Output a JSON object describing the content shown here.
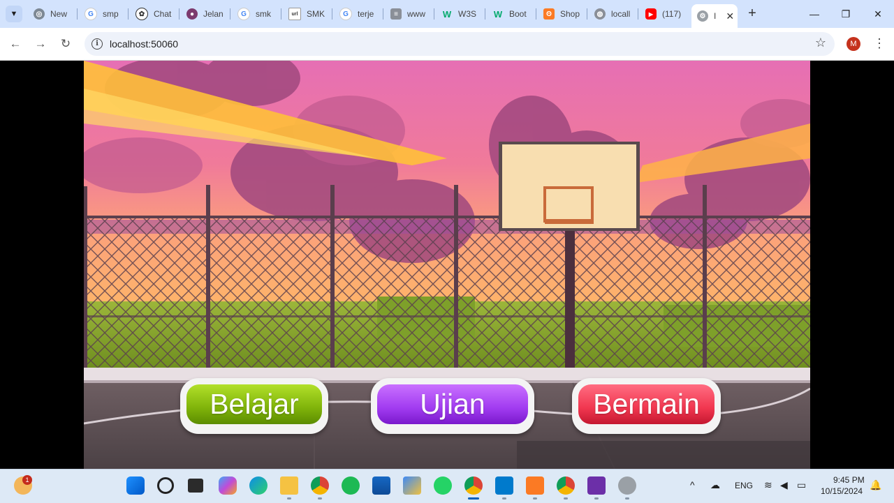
{
  "browser": {
    "tabs": [
      {
        "label": "New",
        "favicon": "chrome-icon"
      },
      {
        "label": "smp",
        "favicon": "google-icon"
      },
      {
        "label": "Chat",
        "favicon": "openai-icon"
      },
      {
        "label": "Jelan",
        "favicon": "site-icon"
      },
      {
        "label": "smk",
        "favicon": "google-icon"
      },
      {
        "label": "SMK",
        "favicon": "site-icon"
      },
      {
        "label": "terje",
        "favicon": "google-icon"
      },
      {
        "label": "www",
        "favicon": "doc-icon"
      },
      {
        "label": "W3S",
        "favicon": "w3schools-icon"
      },
      {
        "label": "Boot",
        "favicon": "w3schools-icon"
      },
      {
        "label": "Shop",
        "favicon": "xampp-icon"
      },
      {
        "label": "locall",
        "favicon": "globe-icon"
      },
      {
        "label": "(117)",
        "favicon": "youtube-icon"
      },
      {
        "label": "I",
        "favicon": "gear-icon",
        "active": true
      }
    ],
    "url": "localhost:50060",
    "profile_initial": "M",
    "colors": {
      "tabstrip": "#d3e3fd",
      "toolbar": "#ffffff",
      "omnibox": "#eef2fa",
      "profile": "#c5321d"
    }
  },
  "game": {
    "buttons": [
      {
        "id": "belajar",
        "label": "Belajar",
        "color": "#8cc20e"
      },
      {
        "id": "ujian",
        "label": "Ujian",
        "color": "#a13bf0"
      },
      {
        "id": "bermain",
        "label": "Bermain",
        "color": "#f1364f"
      }
    ],
    "background": "sunset basketball court with chain-link fence and hoop"
  },
  "taskbar": {
    "weather_badge": "1",
    "apps": [
      "windows-start-icon",
      "search-icon",
      "task-view-icon",
      "copilot-icon",
      "edge-icon",
      "file-explorer-icon",
      "chrome-icon",
      "spotify-icon",
      "microsoft-store-icon",
      "cube-app-icon",
      "whatsapp-icon",
      "chrome-icon",
      "vscode-icon",
      "xampp-icon",
      "chrome-icon",
      "visual-studio-icon",
      "settings-icon"
    ],
    "tray": {
      "language": "ENG",
      "time": "9:45 PM",
      "date": "10/15/2024"
    }
  }
}
